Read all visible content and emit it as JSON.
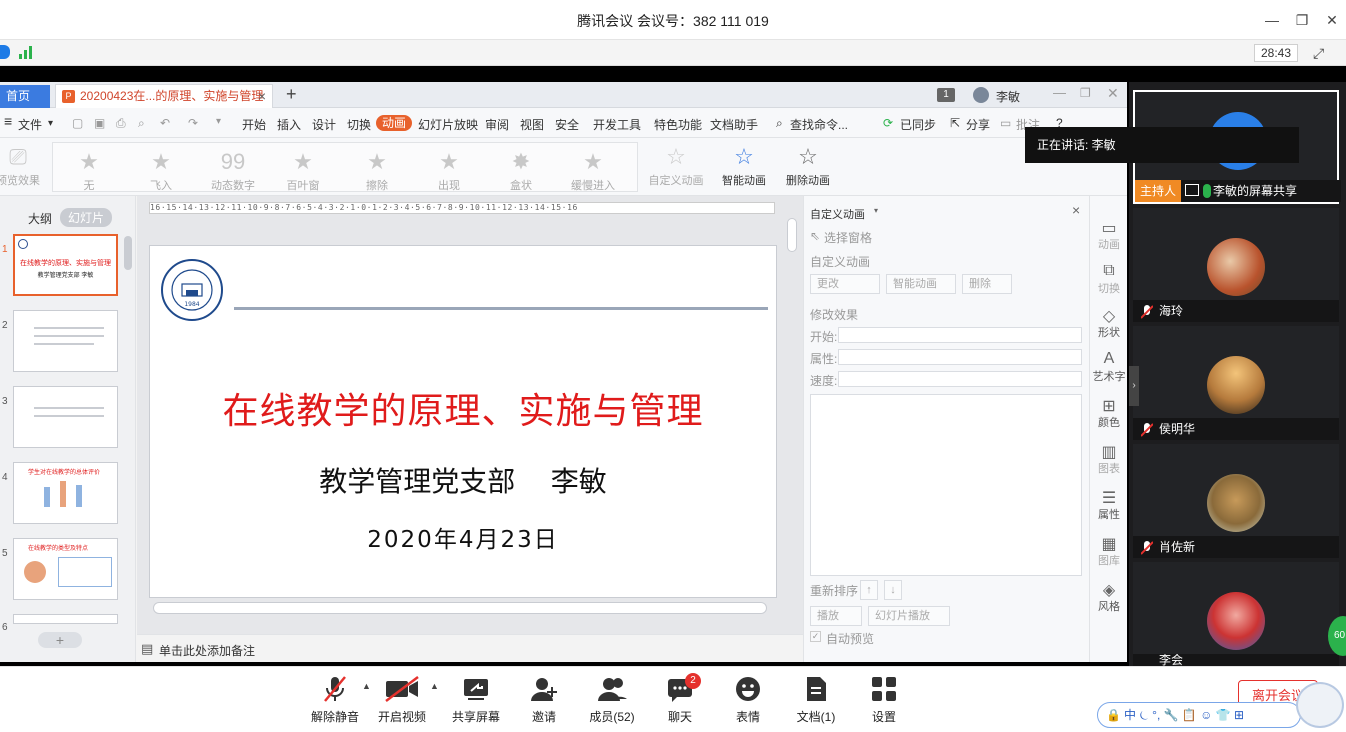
{
  "meeting": {
    "title": "腾讯会议 会议号：382 111 019",
    "timer": "28:43",
    "speaking_tip": "正在讲话: 李敏",
    "accent": "#2a7fe7"
  },
  "wps": {
    "home_tab": "首页",
    "doc_tab": "20200423在...的原理、实施与管理",
    "user_name": "李敏",
    "page_badge": "1",
    "file_menu": "文件",
    "menus": [
      "开始",
      "插入",
      "设计",
      "切换",
      "动画",
      "幻灯片放映",
      "审阅",
      "视图",
      "安全",
      "开发工具",
      "特色功能",
      "文档助手"
    ],
    "search": "查找命令...",
    "sync": "已同步",
    "share": "分享",
    "comment": "批注",
    "ribbon": {
      "preview": "预览效果",
      "effects": [
        "无",
        "飞入",
        "动态数字",
        "百叶窗",
        "擦除",
        "出现",
        "盒状",
        "缓慢进入"
      ],
      "custom": "自定义动画",
      "smart": "智能动画",
      "delete": "删除动画"
    },
    "slide_panel": {
      "outline_tab": "大纲",
      "slides_tab": "幻灯片",
      "thumbs": [
        {
          "num": "1",
          "title": "在线教学的原理、实施与管理",
          "sub": "教学管理党支部 李敏"
        },
        {
          "num": "2",
          "title": "",
          "sub": ""
        },
        {
          "num": "3",
          "title": "",
          "sub": ""
        },
        {
          "num": "4",
          "title": "学生对在线教学的总体评价",
          "sub": ""
        },
        {
          "num": "5",
          "title": "在线教学的类型及特点",
          "sub": ""
        },
        {
          "num": "6",
          "title": "",
          "sub": ""
        }
      ]
    },
    "ruler": "16·15·14·13·12·11·10·9·8·7·6·5·4·3·2·1·0·1·2·3·4·5·6·7·8·9·10·11·12·13·14·15·16",
    "slide": {
      "title": "在线教学的原理、实施与管理",
      "author": "教学管理党支部    李敏",
      "date": "2020年4月23日",
      "logo_text": "北京城市学院 BEIJING CITY UNIVERSITY 1984"
    },
    "notes_hint": "单击此处添加备注",
    "anim_pane": {
      "header": "自定义动画",
      "select_pane": "选择窗格",
      "section_custom": "自定义动画",
      "change_btn": "更改",
      "smart_btn": "智能动画",
      "delete_btn": "删除",
      "section_modify": "修改效果",
      "start_label": "开始:",
      "property_label": "属性:",
      "speed_label": "速度:",
      "reorder_label": "重新排序",
      "play_btn": "播放",
      "slideshow_btn": "幻灯片播放",
      "autopreview_label": "自动预览"
    },
    "side_tools": [
      "动画",
      "切换",
      "形状",
      "艺术字",
      "颜色",
      "图表",
      "属性",
      "图库",
      "风格"
    ]
  },
  "participants": [
    {
      "name": "李敏的屏幕共享",
      "role": "主持人"
    },
    {
      "name": "海玲"
    },
    {
      "name": "侯明华"
    },
    {
      "name": "肖佐新"
    },
    {
      "name": "李会"
    }
  ],
  "toolbar": {
    "mute": "解除静音",
    "video": "开启视频",
    "share": "共享屏幕",
    "invite": "邀请",
    "members": "成员(52)",
    "chat": "聊天",
    "chat_badge": "2",
    "emoji": "表情",
    "docs": "文档(1)",
    "settings": "设置",
    "leave": "离开会议",
    "ime": "中 ⏾ °, 🔧 📋 ☺ 👕 ⊞",
    "net_badge": "60"
  }
}
